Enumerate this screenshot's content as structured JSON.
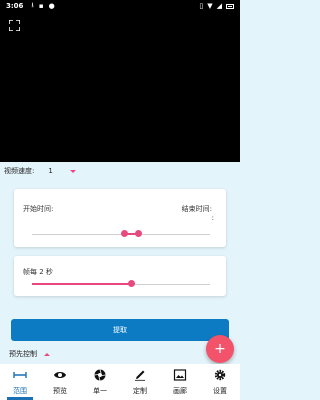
{
  "status_bar": {
    "time": "3:06",
    "icons": [
      "download-icon",
      "notification-icon",
      "circle-icon"
    ],
    "right_icons": [
      "vibrate-icon",
      "wifi-icon",
      "signal-icon",
      "battery-icon"
    ]
  },
  "video": {
    "fullscreen_icon": "fullscreen-icon"
  },
  "speed": {
    "label": "视频速度:",
    "value": "1"
  },
  "time_card": {
    "start_label": "开始时间:",
    "end_label": "结束时间:",
    "end_value": ":",
    "range_start_fraction": 0.52,
    "range_end_fraction": 0.6
  },
  "fps_card": {
    "label": "帧每 2 秒",
    "value_fraction": 0.56
  },
  "extract_button": "提取",
  "fab": {
    "label": "+"
  },
  "preview_control": {
    "label": "预先控制"
  },
  "nav": {
    "items": [
      {
        "label": "范围",
        "icon": "range-icon",
        "active": true
      },
      {
        "label": "预览",
        "icon": "eye-icon",
        "active": false
      },
      {
        "label": "单一",
        "icon": "aperture-icon",
        "active": false
      },
      {
        "label": "定制",
        "icon": "pencil-icon",
        "active": false
      },
      {
        "label": "画廊",
        "icon": "gallery-icon",
        "active": false
      },
      {
        "label": "设置",
        "icon": "gear-icon",
        "active": false
      }
    ]
  },
  "colors": {
    "accent": "#e84a7f",
    "primary": "#0d7bc4",
    "fab": "#f2536a",
    "background": "#e4f4fb"
  }
}
